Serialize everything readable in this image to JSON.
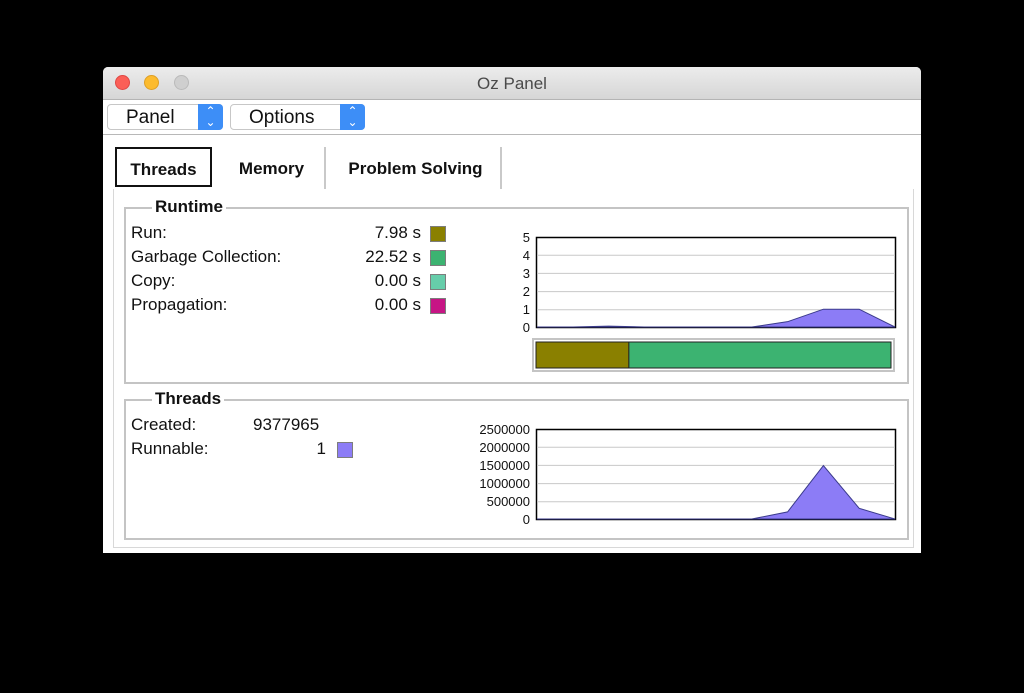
{
  "window": {
    "title": "Oz Panel"
  },
  "menubar": {
    "panel_label": "Panel",
    "options_label": "Options"
  },
  "tabs": [
    "Threads",
    "Memory",
    "Problem Solving"
  ],
  "selected_tab": "Threads",
  "runtime": {
    "title": "Runtime",
    "rows": [
      {
        "label": "Run:",
        "value": "7.98 s",
        "color": "#8a8000"
      },
      {
        "label": "Garbage Collection:",
        "value": "22.52 s",
        "color": "#3cb371"
      },
      {
        "label": "Copy:",
        "value": "0.00 s",
        "color": "#66cdaa"
      },
      {
        "label": "Propagation:",
        "value": "0.00 s",
        "color": "#c71585"
      }
    ],
    "chart_data": {
      "type": "area",
      "y_ticks": [
        "5",
        "4",
        "3",
        "2",
        "1",
        "0"
      ],
      "ylim": [
        0,
        5
      ],
      "x": [
        0,
        10,
        20,
        30,
        40,
        50,
        60,
        70,
        80,
        90,
        100
      ],
      "values": [
        0,
        0,
        0.05,
        0,
        0,
        0,
        0,
        0.3,
        1,
        1,
        0
      ],
      "color": "#8c7cf6"
    },
    "bar": [
      {
        "name": "Run",
        "value": 7.98,
        "color": "#8a8000"
      },
      {
        "name": "Garbage Collection",
        "value": 22.52,
        "color": "#3cb371"
      }
    ]
  },
  "threads": {
    "title": "Threads",
    "created_label": "Created:",
    "created_value": "9377965",
    "runnable_label": "Runnable:",
    "runnable_value": "1",
    "runnable_color": "#8c7cf6",
    "chart_data": {
      "type": "area",
      "y_ticks": [
        "2500000",
        "2000000",
        "1500000",
        "1000000",
        "500000",
        "0"
      ],
      "ylim": [
        0,
        2500000
      ],
      "x": [
        0,
        10,
        20,
        30,
        40,
        50,
        60,
        70,
        80,
        90,
        100
      ],
      "values": [
        0,
        0,
        0,
        0,
        0,
        0,
        0,
        200000,
        1500000,
        300000,
        0
      ],
      "color": "#8c7cf6"
    }
  }
}
